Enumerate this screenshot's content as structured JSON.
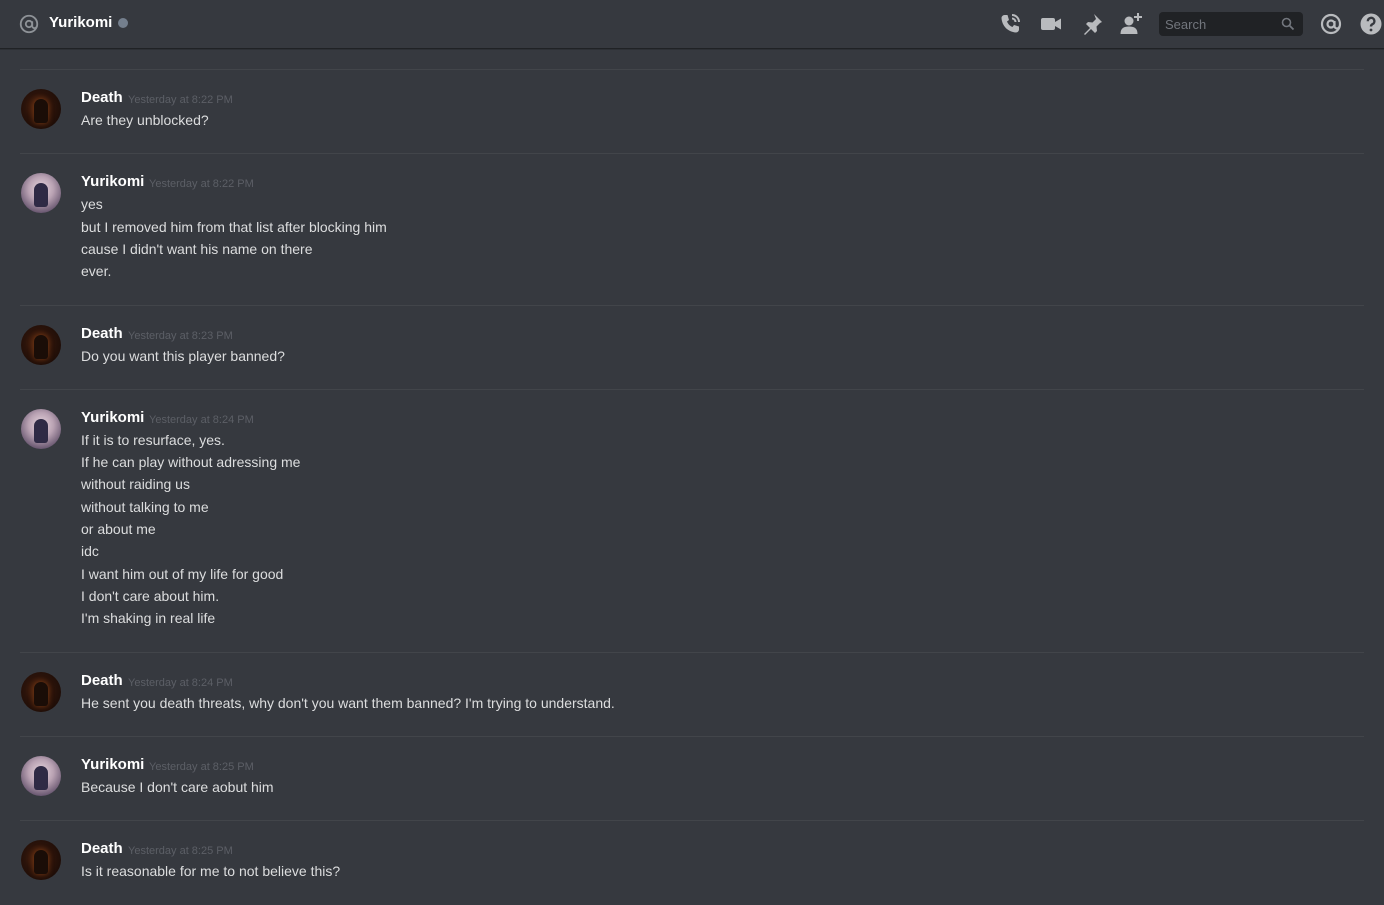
{
  "header": {
    "channel_name": "Yurikomi",
    "search_placeholder": "Search",
    "icons": [
      "at-icon",
      "call-icon",
      "video-icon",
      "pin-icon",
      "add-friend-icon",
      "search-icon",
      "mentions-icon",
      "help-icon"
    ]
  },
  "colors": {
    "background": "#36393f",
    "header_bg": "#36393f",
    "username": "#ffffff",
    "message_text": "#dcddde",
    "timestamp": "#5c5f66",
    "divider": "#42454a",
    "status_offline": "#747f8d",
    "search_bg": "#202225"
  },
  "messages": [
    {
      "author": "Death",
      "timestamp": "Yesterday at 8:22 PM",
      "avatar": "death-avatar",
      "lines": [
        "Are they unblocked?"
      ]
    },
    {
      "author": "Yurikomi",
      "timestamp": "Yesterday at 8:22 PM",
      "avatar": "yurikomi-avatar",
      "lines": [
        "yes",
        "but I removed him from that list after blocking him",
        "cause I didn't want his name on there",
        "ever."
      ]
    },
    {
      "author": "Death",
      "timestamp": "Yesterday at 8:23 PM",
      "avatar": "death-avatar",
      "lines": [
        "Do you want this player banned?"
      ]
    },
    {
      "author": "Yurikomi",
      "timestamp": "Yesterday at 8:24 PM",
      "avatar": "yurikomi-avatar",
      "lines": [
        "If it is to resurface, yes.",
        "If he can play without adressing me",
        "without raiding us",
        "without talking to me",
        "or about me",
        "idc",
        "I want him out of my life for good",
        "I don't care about him.",
        "I'm shaking in real life"
      ]
    },
    {
      "author": "Death",
      "timestamp": "Yesterday at 8:24 PM",
      "avatar": "death-avatar",
      "lines": [
        "He sent you death threats, why don't you want them banned? I'm trying to understand."
      ]
    },
    {
      "author": "Yurikomi",
      "timestamp": "Yesterday at 8:25 PM",
      "avatar": "yurikomi-avatar",
      "lines": [
        "Because I don't care aobut him"
      ]
    },
    {
      "author": "Death",
      "timestamp": "Yesterday at 8:25 PM",
      "avatar": "death-avatar",
      "lines": [
        "Is it reasonable for me to not believe this?"
      ]
    }
  ]
}
